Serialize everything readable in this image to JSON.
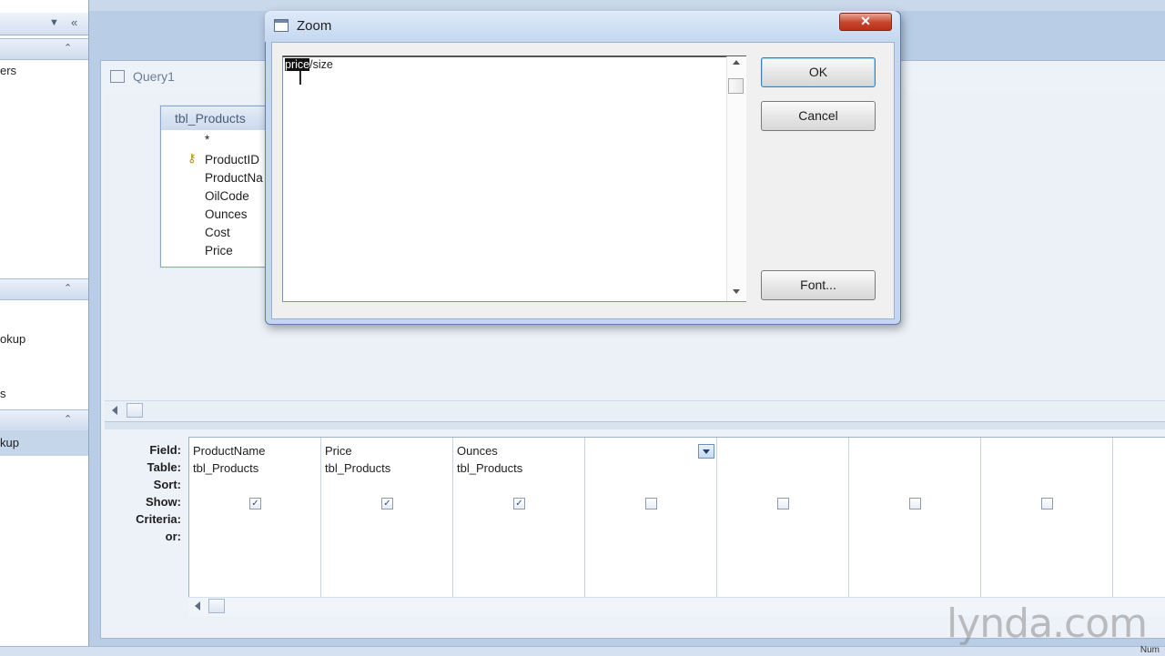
{
  "nav": {
    "items": [
      {
        "label": "ers"
      },
      {
        "label": "okup"
      },
      {
        "label": "s"
      },
      {
        "label": "kup"
      }
    ]
  },
  "query": {
    "tab_title": "Query1"
  },
  "field_list": {
    "title": "tbl_Products",
    "fields": [
      "*",
      "ProductID",
      "ProductNa",
      "OilCode",
      "Ounces",
      "Cost",
      "Price"
    ]
  },
  "grid": {
    "row_labels": [
      "Field:",
      "Table:",
      "Sort:",
      "Show:",
      "Criteria:",
      "or:"
    ],
    "columns": [
      {
        "field": "ProductName",
        "table": "tbl_Products",
        "show": true
      },
      {
        "field": "Price",
        "table": "tbl_Products",
        "show": true
      },
      {
        "field": "Ounces",
        "table": "tbl_Products",
        "show": true
      },
      {
        "field": "",
        "table": "",
        "show": false
      },
      {
        "field": "",
        "table": "",
        "show": false
      },
      {
        "field": "",
        "table": "",
        "show": false
      },
      {
        "field": "",
        "table": "",
        "show": false
      }
    ]
  },
  "zoom": {
    "title": "Zoom",
    "text_selected": "price",
    "text_rest": "/size",
    "ok_label": "OK",
    "cancel_label": "Cancel",
    "font_label": "Font...",
    "close_label": "✕"
  },
  "status": {
    "num": "Num"
  },
  "watermark": "lynda.com",
  "colors": {
    "accent": "#3c7fb1",
    "close": "#c7432b",
    "workspace": "#b9cde6"
  }
}
